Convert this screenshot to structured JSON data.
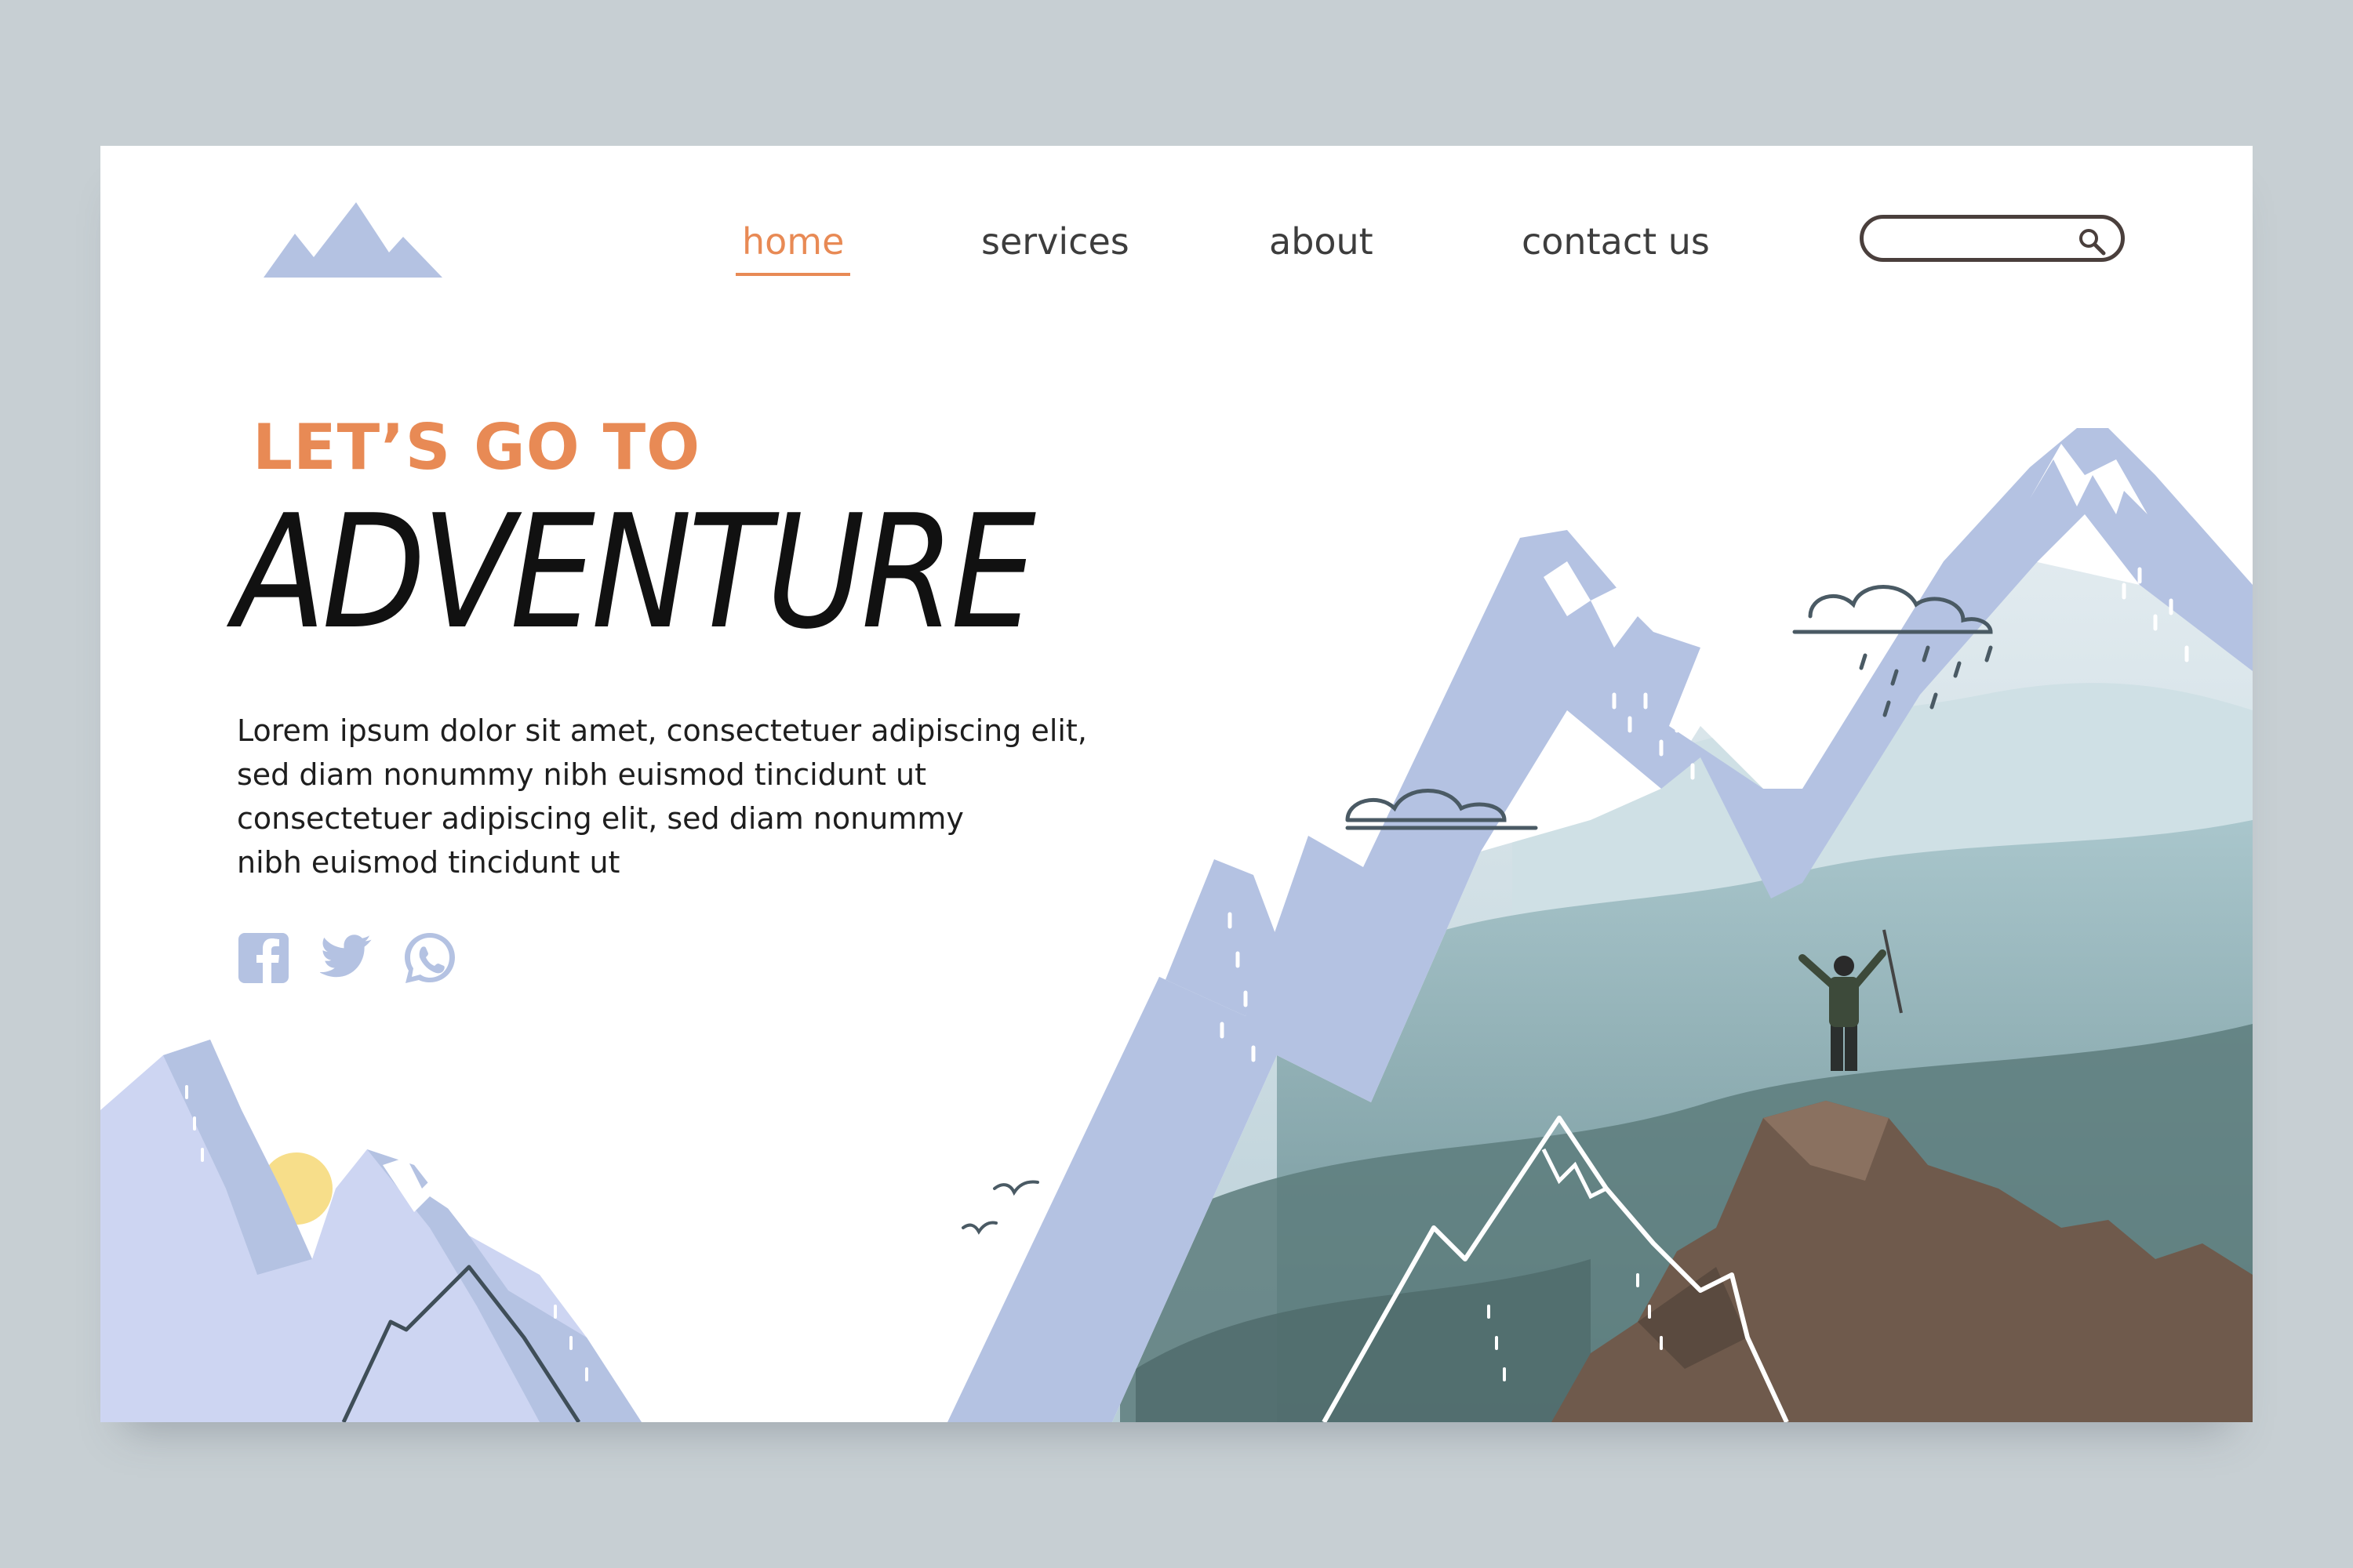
{
  "nav": {
    "items": [
      {
        "label": "home",
        "active": true
      },
      {
        "label": "services",
        "active": false
      },
      {
        "label": "about",
        "active": false
      },
      {
        "label": "contact us",
        "active": false
      }
    ]
  },
  "search": {
    "placeholder": "",
    "value": ""
  },
  "hero": {
    "eyebrow": "LET’S GO TO",
    "headline": "ADVENTURE",
    "body_lines": [
      "Lorem ipsum dolor sit amet, consectetuer adipiscing elit,",
      "sed diam nonummy nibh euismod tincidunt ut",
      "consectetuer adipiscing elit, sed diam nonummy",
      "nibh euismod tincidunt ut"
    ]
  },
  "social": [
    "facebook-icon",
    "twitter-icon",
    "whatsapp-icon"
  ],
  "colors": {
    "accent": "#e88a55",
    "mountain": "#b4c2e2",
    "mountain_light": "#cdd5f2",
    "sun": "#f7de8a",
    "page_bg": "#c7cfd3",
    "text_dark": "#3d3d3d"
  }
}
